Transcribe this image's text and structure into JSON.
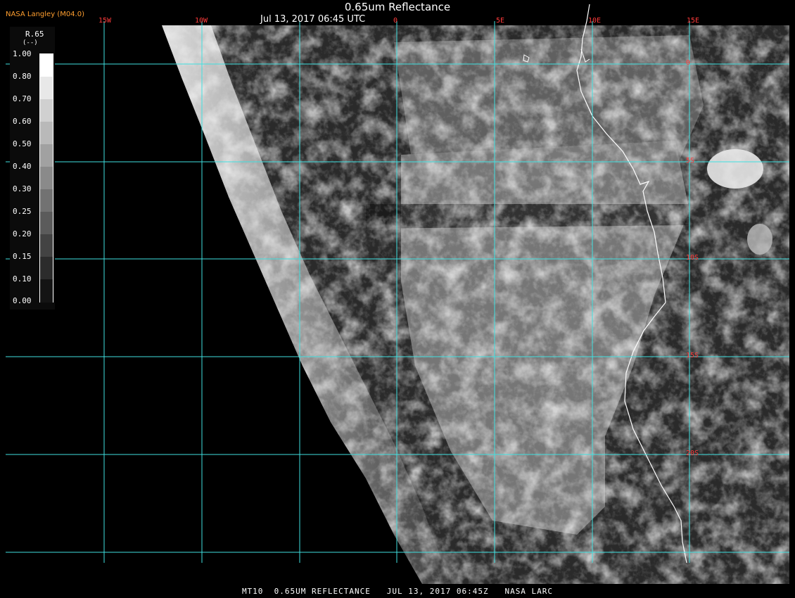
{
  "header": {
    "title": "0.65um Reflectance",
    "timestamp": "Jul 13, 2017 06:45 UTC",
    "provider": "NASA Langley (M04.0)"
  },
  "footer": {
    "caption": "MT10  0.65UM REFLECTANCE   JUL 13, 2017 06:45Z   NASA LARC"
  },
  "legend": {
    "variable": "R.65",
    "unit": "(--)",
    "ticks": [
      "1.00",
      "0.80",
      "0.70",
      "0.60",
      "0.50",
      "0.40",
      "0.30",
      "0.25",
      "0.20",
      "0.15",
      "0.10",
      "0.00"
    ]
  },
  "map": {
    "lon_labels": [
      "15W",
      "10W",
      "0",
      "5E",
      "10E",
      "15E"
    ],
    "lat_labels": [
      "0",
      "5S",
      "10S",
      "15S",
      "20S"
    ],
    "colors": {
      "grid": "#3fe0e0",
      "labels": "#ff3b3b",
      "coastline": "#ffffff",
      "space": "#000000"
    }
  }
}
